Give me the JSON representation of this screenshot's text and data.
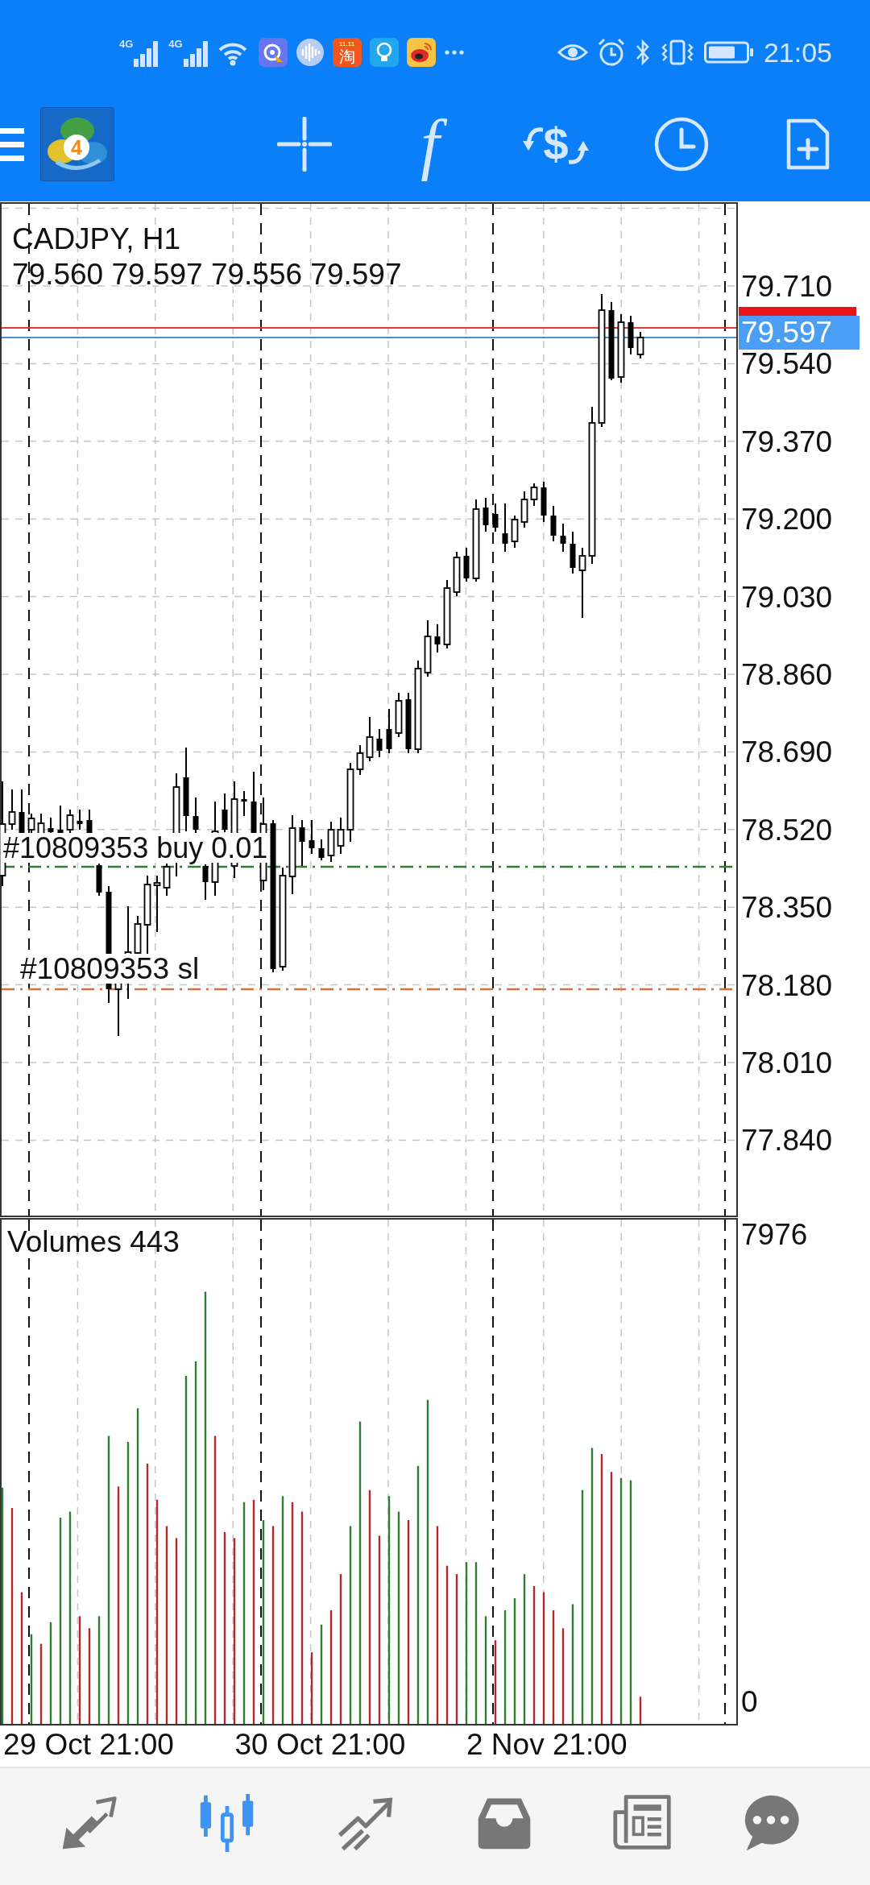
{
  "status_bar": {
    "network_labels": [
      "4G",
      "4G"
    ],
    "shop_sale_text": "11.11",
    "shop_glyph": "淘",
    "time": "21:05"
  },
  "toolbar": {
    "logo_number": "4",
    "buttons": [
      {
        "kind": "crosshair"
      },
      {
        "kind": "indicators",
        "glyph": "f"
      },
      {
        "kind": "exchange",
        "glyph": "$"
      },
      {
        "kind": "timeframe"
      },
      {
        "kind": "new_order"
      }
    ]
  },
  "chart": {
    "symbol": "CADJPY, H1",
    "ohlc": "79.560 79.597 79.556 79.597",
    "price_scale": [
      "79.710",
      "79.540",
      "79.370",
      "79.200",
      "79.030",
      "78.860",
      "78.690",
      "78.520",
      "78.350",
      "78.180",
      "78.010",
      "77.840"
    ],
    "bid_price": "79.597",
    "orders": [
      {
        "kind": "entry",
        "label": "#10809353 buy 0.01"
      },
      {
        "kind": "stop_loss",
        "label": "#10809353 sl"
      }
    ]
  },
  "volumes": {
    "title": "Volumes 443",
    "scale_max": "7976",
    "scale_min": "0"
  },
  "time_axis": [
    "29 Oct 21:00",
    "30 Oct 21:00",
    "2 Nov 21:00"
  ],
  "bottom_nav": [
    {
      "kind": "quotes",
      "selected": false
    },
    {
      "kind": "chart",
      "selected": true
    },
    {
      "kind": "trade",
      "selected": false
    },
    {
      "kind": "history",
      "selected": false
    },
    {
      "kind": "news",
      "selected": false
    },
    {
      "kind": "chat",
      "selected": false
    }
  ]
}
